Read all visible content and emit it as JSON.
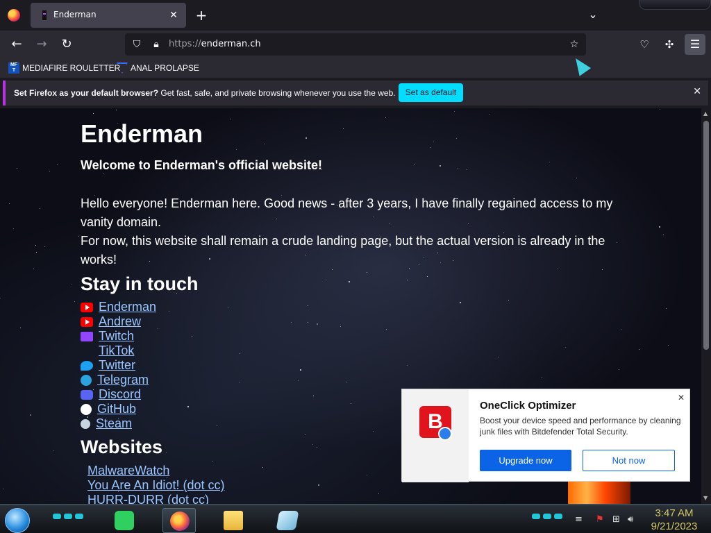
{
  "browser": {
    "tab": {
      "title": "Enderman",
      "close": "✕"
    },
    "new_tab": "+",
    "tab_list": "⌄",
    "url": {
      "scheme": "https://",
      "host": "enderman.ch"
    },
    "bookmarks": [
      {
        "label": "MEDIAFIRE ROULETTER",
        "icon": "mediafire-icon",
        "icon_text": "MF\nT"
      },
      {
        "label": "ANAL PROLAPSE",
        "icon": "triangle-icon"
      }
    ],
    "notification": {
      "bold": "Set Firefox as your default browser?",
      "text": " Get fast, safe, and private browsing whenever you use the web.",
      "button": "Set as default",
      "close": "✕"
    }
  },
  "page": {
    "title": "Enderman",
    "welcome": "Welcome to Enderman's official website!",
    "para1": "Hello everyone! Enderman here. Good news - after 3 years, I have finally regained access to my vanity domain.",
    "para2": "For now, this website shall remain a crude landing page, but the actual version is already in the works!",
    "stay_heading": "Stay in touch",
    "social_links": [
      {
        "label": "Enderman",
        "icon": "youtube-icon"
      },
      {
        "label": "Andrew",
        "icon": "youtube-icon"
      },
      {
        "label": "Twitch",
        "icon": "twitch-icon"
      },
      {
        "label": "TikTok",
        "icon": "tiktok-icon"
      },
      {
        "label": "Twitter",
        "icon": "twitter-icon"
      },
      {
        "label": "Telegram",
        "icon": "telegram-icon"
      },
      {
        "label": "Discord",
        "icon": "discord-icon"
      },
      {
        "label": "GitHub",
        "icon": "github-icon"
      },
      {
        "label": "Steam",
        "icon": "steam-icon"
      }
    ],
    "websites_heading": "Websites",
    "website_links": [
      "MalwareWatch",
      "You Are An Idiot! (dot cc)",
      "HURR-DURR (dot cc)"
    ]
  },
  "popup": {
    "title": "OneClick Optimizer",
    "description": "Boost your device speed and performance by cleaning junk files with Bitdefender Total Security.",
    "logo_letter": "B",
    "upgrade_button": "Upgrade now",
    "not_now_button": "Not now",
    "close": "✕"
  },
  "taskbar": {
    "time": "3:47 AM",
    "date": "9/21/2023",
    "apps": [
      "notepad-icon",
      "firefox-icon",
      "file-explorer-icon",
      "bitdefender-icon"
    ]
  },
  "colors": {
    "accent": "#00ddff",
    "link": "#9ac5ff",
    "popup_button": "#0b63e5",
    "bitdefender_red": "#e1131c"
  }
}
